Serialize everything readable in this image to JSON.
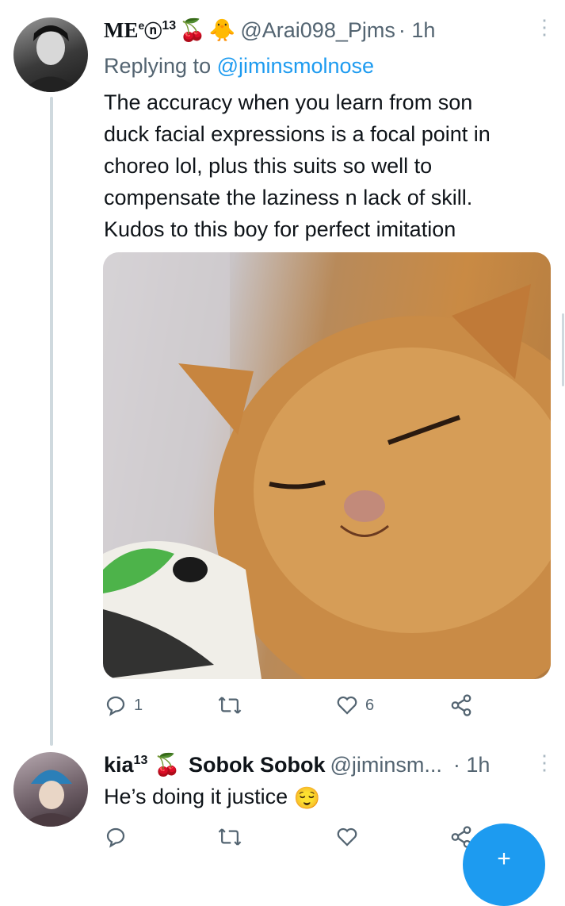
{
  "tweet1": {
    "name": "ME",
    "name_suffix": "ⓝ",
    "superscript": "13",
    "emoji1": "🍒",
    "emoji2": "🐥",
    "handle": "@Arai098_Pjms",
    "time": "· 1h",
    "replying_label": "Replying to",
    "replying_to": "@jiminsmolnose",
    "lines": [
      "The accuracy when you learn from son",
      "duck facial expressions is a focal point in",
      "choreo lol, plus this suits so well to",
      "compensate the laziness n lack of skill.",
      "Kudos to this boy for perfect imitation"
    ],
    "reply_count": "1",
    "retweet_count": "",
    "like_count": "6"
  },
  "tweet2": {
    "name": "kia",
    "superscript": "13",
    "emoji1": "🍒",
    "display_name": "Sobok Sobok",
    "handle": "@jiminsm...",
    "time": "· 1h",
    "text": "He’s doing it justice",
    "text_emoji": "😌"
  },
  "fab": {
    "label": "+"
  }
}
